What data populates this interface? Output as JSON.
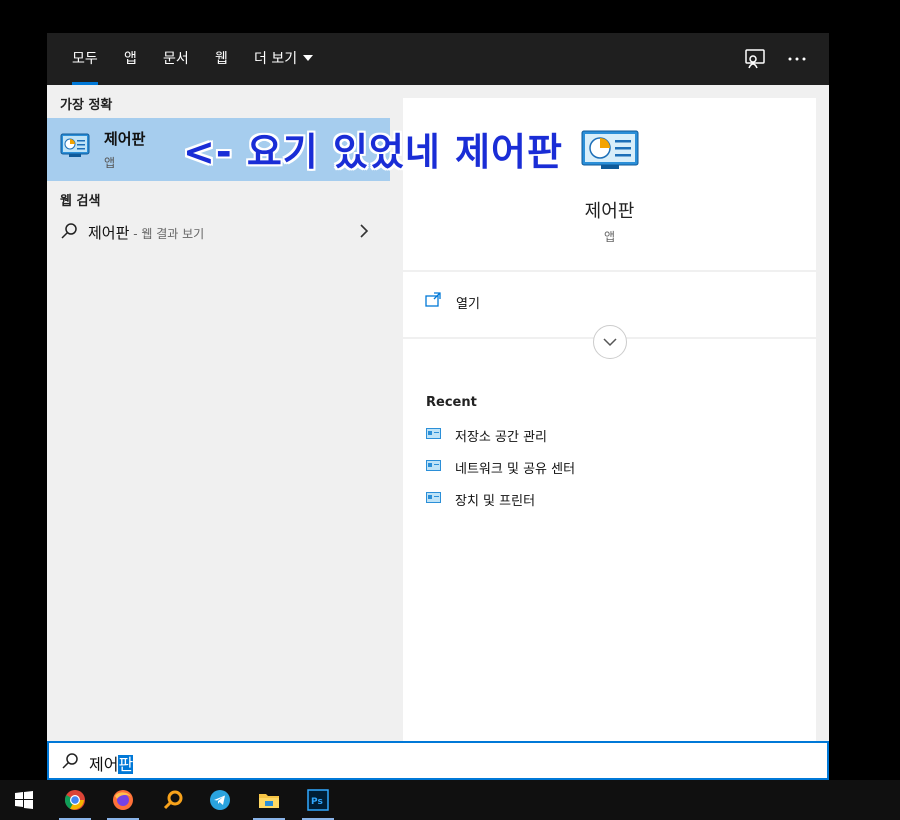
{
  "tabs": [
    "모두",
    "앱",
    "문서",
    "웹",
    "더 보기"
  ],
  "left": {
    "best_match_title": "가장 정확",
    "best_match": {
      "title": "제어판",
      "subtitle": "앱"
    },
    "web_search_title": "웹 검색",
    "web_result": {
      "query": "제어판",
      "suffix": " - 웹 결과 보기"
    }
  },
  "detail": {
    "title": "제어판",
    "subtitle": "앱",
    "open_label": "열기",
    "recent_title": "Recent",
    "recent_items": [
      "저장소 공간 관리",
      "네트워크 및 공유 센터",
      "장치 및 프린터"
    ]
  },
  "annotation": "<- 요기 있었네 제어판",
  "search": {
    "typed": "제어",
    "selected": "판"
  },
  "taskbar_apps": [
    "start-icon",
    "chrome-icon",
    "firefox-icon",
    "search-app-icon",
    "telegram-icon",
    "file-explorer-icon",
    "photoshop-icon"
  ],
  "colors": {
    "accent": "#0078d7",
    "selection": "#a6cdee",
    "annotation": "#1a2dd6"
  }
}
